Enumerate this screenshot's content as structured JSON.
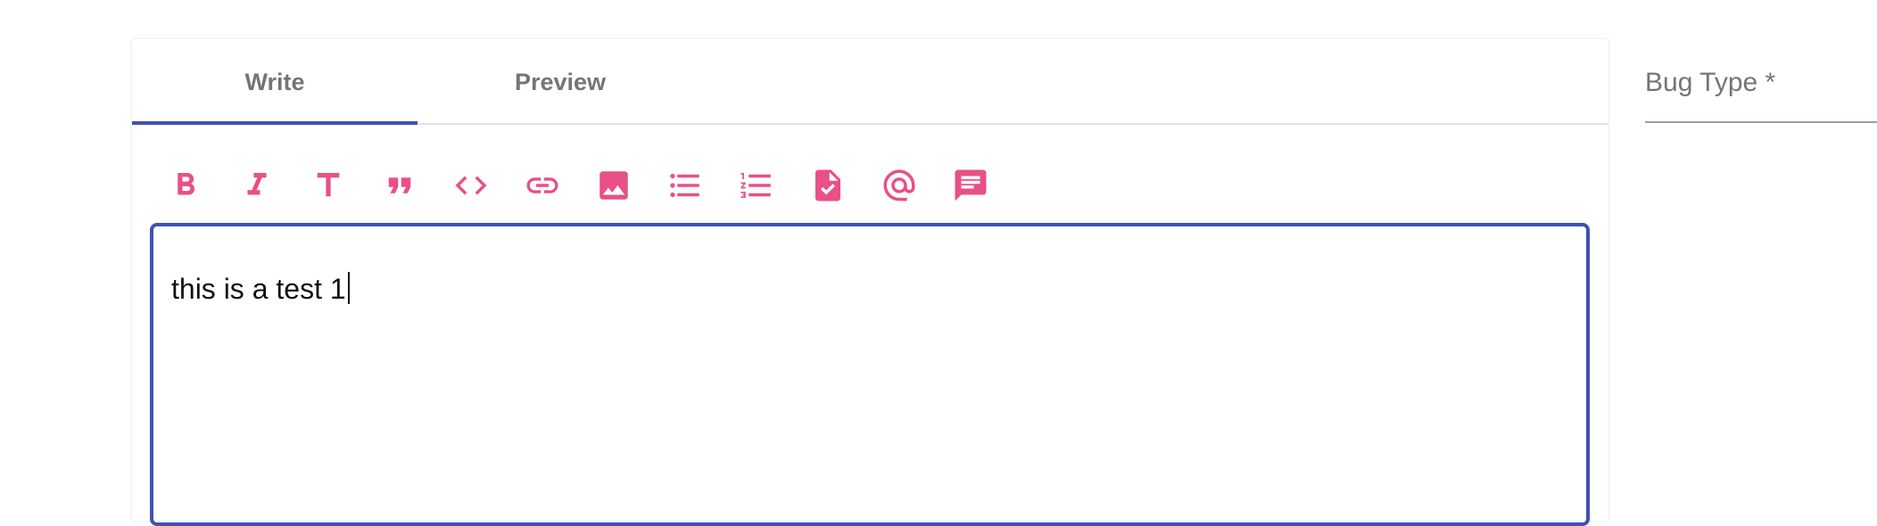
{
  "tabs": [
    {
      "label": "Write",
      "active": true
    },
    {
      "label": "Preview",
      "active": false
    }
  ],
  "toolbar": {
    "icons": [
      "bold-icon",
      "italic-icon",
      "header-icon",
      "quote-icon",
      "code-icon",
      "link-icon",
      "image-icon",
      "bulleted-list-icon",
      "numbered-list-icon",
      "task-list-icon",
      "mention-icon",
      "saved-reply-icon"
    ],
    "accent_color": "#e85086"
  },
  "editor": {
    "value": "this is a test 1",
    "focus_color": "#3f51b5"
  },
  "bug_type": {
    "label": "Bug Type *"
  }
}
